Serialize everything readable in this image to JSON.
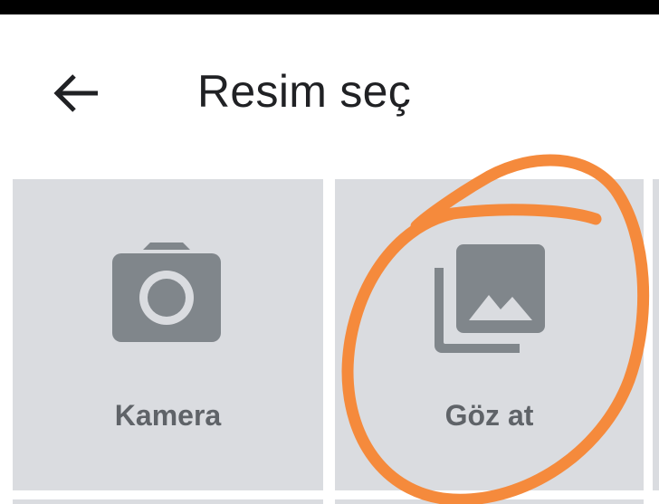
{
  "header": {
    "title": "Resim seç",
    "back_icon": "arrow-back-icon"
  },
  "tiles": [
    {
      "label": "Kamera",
      "icon": "camera-icon"
    },
    {
      "label": "Göz at",
      "icon": "photo-library-icon"
    }
  ],
  "colors": {
    "tile_bg": "#dadce0",
    "icon_gray": "#80868b",
    "label_gray": "#5f6368",
    "title_text": "#202124",
    "annotation_orange": "#f58a3c"
  }
}
